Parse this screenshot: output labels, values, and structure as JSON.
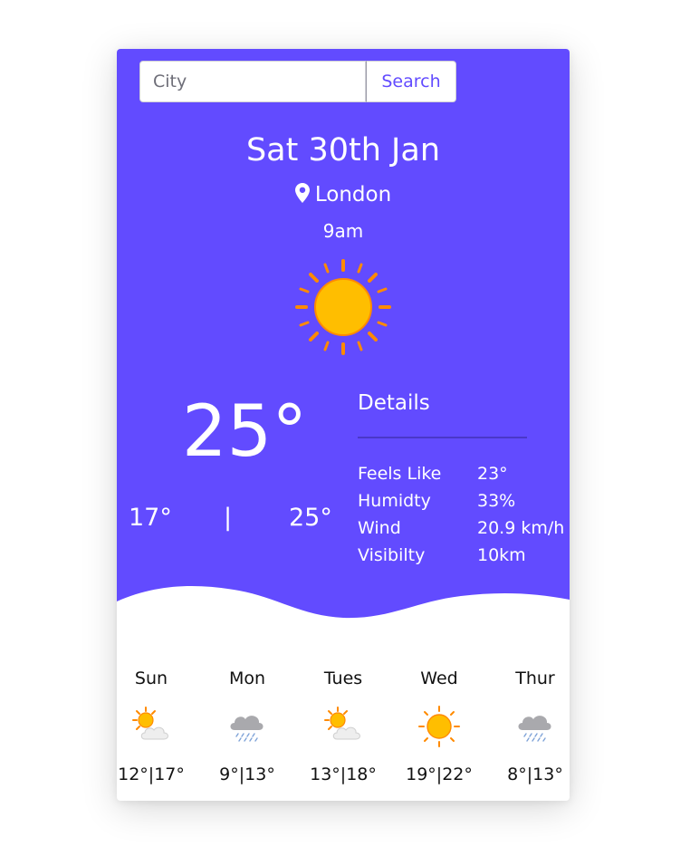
{
  "search": {
    "placeholder": "City",
    "button_label": "Search"
  },
  "current": {
    "date": "Sat 30th Jan",
    "location": "London",
    "time": "9am",
    "icon": "sun-icon",
    "temperature": "25°",
    "low": "17°",
    "separator": "|",
    "high": "25°"
  },
  "details": {
    "title": "Details",
    "rows": [
      {
        "label": "Feels Like",
        "value": "23°"
      },
      {
        "label": "Humidty",
        "value": "33%"
      },
      {
        "label": "Wind",
        "value": "20.9 km/h"
      },
      {
        "label": "Visibilty",
        "value": "10km"
      }
    ]
  },
  "forecast": [
    {
      "day": "Sun",
      "icon": "partly-cloudy-icon",
      "temps": "12°|17°"
    },
    {
      "day": "Mon",
      "icon": "rain-cloud-icon",
      "temps": "9°|13°"
    },
    {
      "day": "Tues",
      "icon": "partly-cloudy-icon",
      "temps": "13°|18°"
    },
    {
      "day": "Wed",
      "icon": "sun-icon",
      "temps": "19°|22°"
    },
    {
      "day": "Thur",
      "icon": "rain-cloud-icon",
      "temps": "8°|13°"
    }
  ],
  "colors": {
    "accent": "#624bff",
    "sun": "#ffbe00",
    "sun_outline": "#ff8a00",
    "cloud": "#a9a9ad",
    "text_dark": "#111111"
  }
}
